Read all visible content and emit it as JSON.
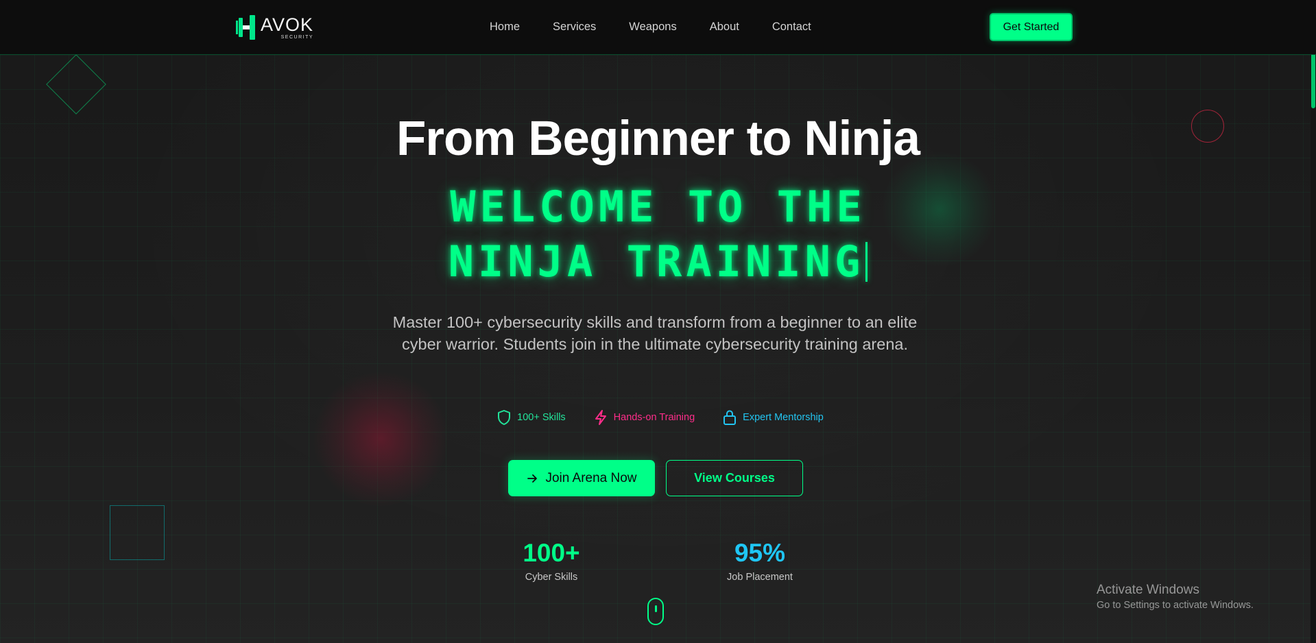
{
  "brand": {
    "name": "AVOK",
    "tagline": "SECURITY",
    "accent": "#00ff88"
  },
  "nav": {
    "items": [
      {
        "label": "Home"
      },
      {
        "label": "Services"
      },
      {
        "label": "Weapons"
      },
      {
        "label": "About"
      },
      {
        "label": "Contact"
      }
    ],
    "cta_label": "Get Started"
  },
  "hero": {
    "title": "From Beginner to Ninja",
    "typed_line1": "WELCOME TO THE",
    "typed_line2": "NINJA TRAINING",
    "subtitle": "Master 100+ cybersecurity skills and transform from a beginner to an elite cyber warrior. Students join in the ultimate cybersecurity training arena."
  },
  "features": [
    {
      "label": "100+ Skills",
      "icon": "shield-icon",
      "color": "#22e39a"
    },
    {
      "label": "Hands-on Training",
      "icon": "lightning-icon",
      "color": "#ff2d8a"
    },
    {
      "label": "Expert Mentorship",
      "icon": "lock-icon",
      "color": "#22c4f0"
    }
  ],
  "buttons": {
    "primary_label": "Join Arena Now",
    "primary_icon": "arrow-right-icon",
    "secondary_label": "View Courses"
  },
  "stats": [
    {
      "value": "100+",
      "label": "Cyber Skills",
      "color": "#00ff88"
    },
    {
      "value": "95%",
      "label": "Job Placement",
      "color": "#1fc6f5"
    }
  ],
  "windows_notice": {
    "title": "Activate Windows",
    "subtitle": "Go to Settings to activate Windows."
  }
}
